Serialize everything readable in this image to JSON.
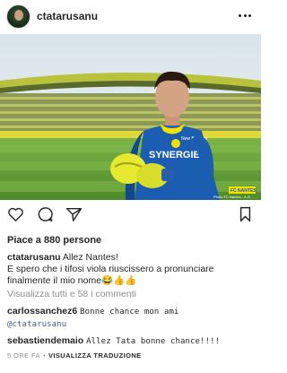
{
  "post": {
    "username": "ctatarusanu",
    "likes_text": "Piace a 880 persone",
    "caption_user": "ctatarusanu",
    "caption_lines": [
      "Allez Nantes!",
      "E spero che i tifosi viola riuscissero a pronunciare",
      "finalmente il mio nome"
    ],
    "caption_emoji": "😂👍👍",
    "view_comments": "Visualizza tutti e 58 i commenti",
    "comments": [
      {
        "user": "carlossanchez6",
        "text": "Bonne chance mon ami",
        "mention": "@ctatarusanu"
      },
      {
        "user": "sebastiendemaio",
        "text": "Allez Tata bonne chance!!!!"
      }
    ],
    "time_ago": "5 ORE FA",
    "separator": "•",
    "translate_label": "VISUALIZZA TRADUZIONE",
    "photo": {
      "jersey_sponsor": "SYNERGIE",
      "jersey_brand": "New Balance",
      "club_badge": "FC NANTES",
      "credit": "Photo FC Nantes - A.G."
    }
  },
  "colors": {
    "jersey": "#1b5db0",
    "pitch": "#6aa43c",
    "glove": "#e6e92f",
    "accent_yellow": "#f3e100"
  },
  "icons": [
    "heart-icon",
    "comment-icon",
    "share-icon",
    "bookmark-icon",
    "more-icon"
  ]
}
